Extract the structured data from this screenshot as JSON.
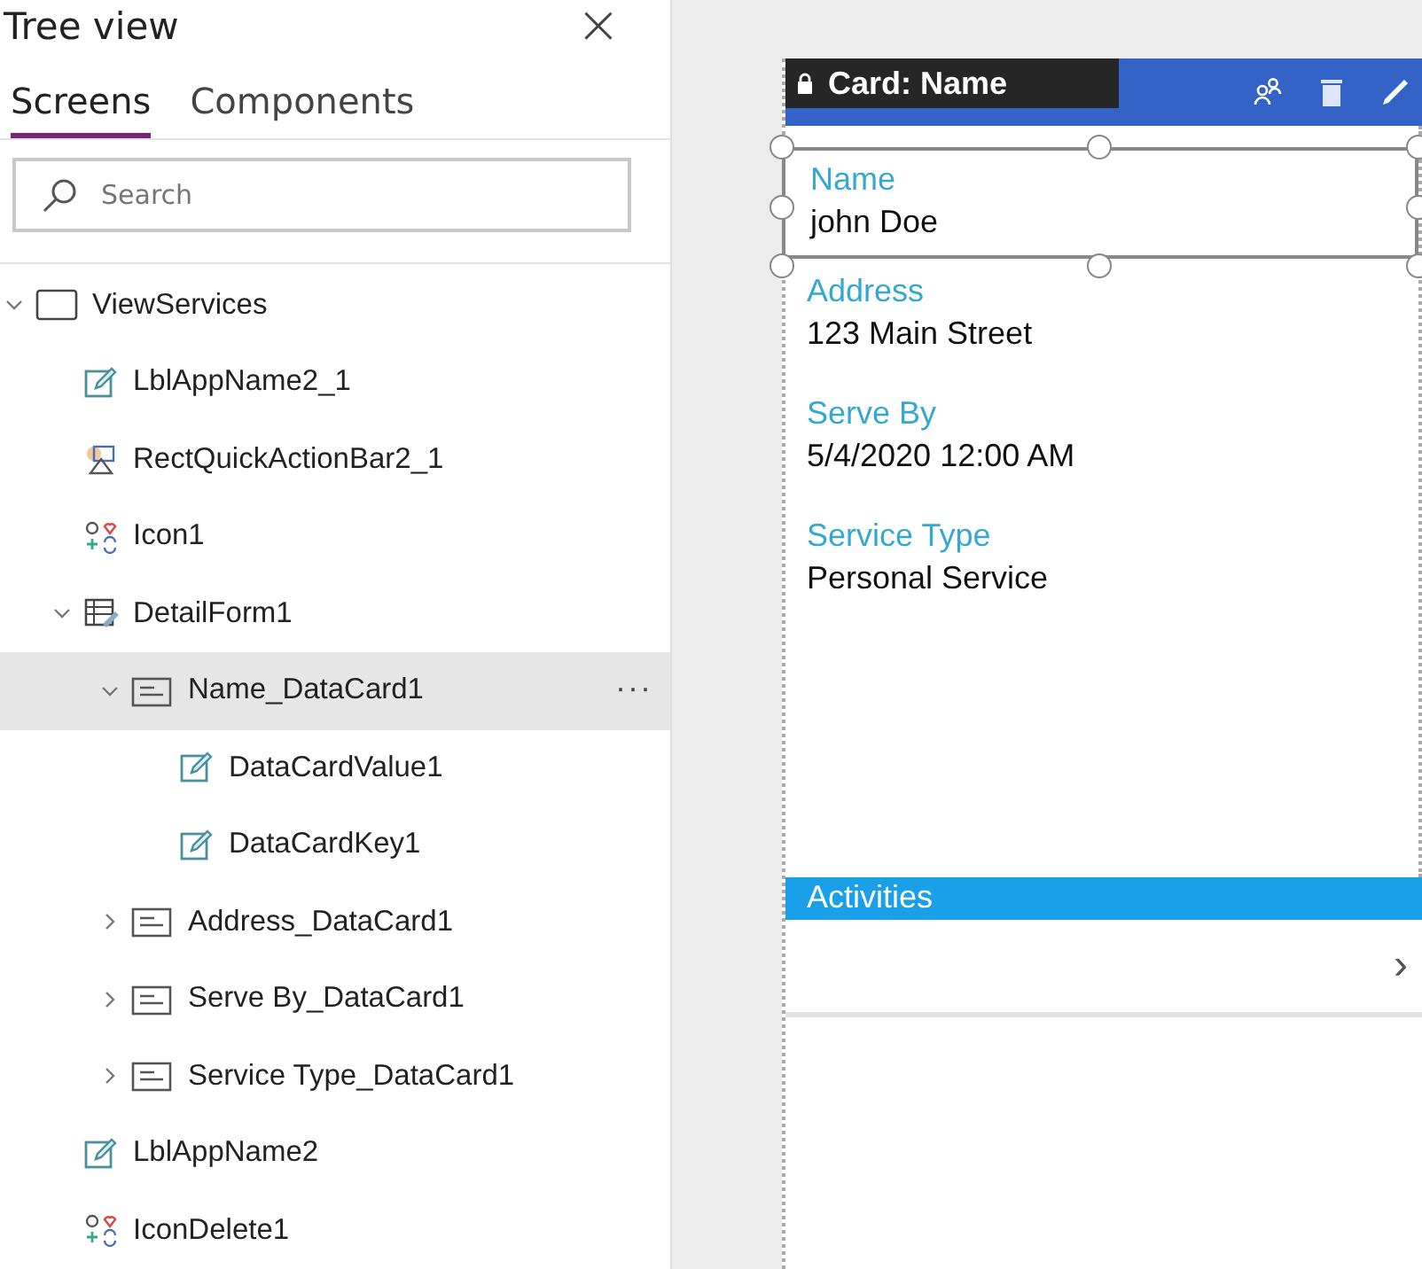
{
  "panel": {
    "title": "Tree view",
    "close": "×"
  },
  "tabs": [
    {
      "label": "Screens",
      "selected": true
    },
    {
      "label": "Components",
      "selected": false
    }
  ],
  "search": {
    "placeholder": "Search"
  },
  "tree": [
    {
      "name": "ViewServices",
      "kind": "screen",
      "expanded": true,
      "selected": false,
      "children": [
        {
          "name": "LblAppName2_1",
          "kind": "label",
          "selected": false
        },
        {
          "name": "RectQuickActionBar2_1",
          "kind": "rect",
          "selected": false
        },
        {
          "name": "Icon1",
          "kind": "icon",
          "selected": false
        },
        {
          "name": "DetailForm1",
          "kind": "form",
          "expanded": true,
          "selected": false,
          "children": [
            {
              "name": "Name_DataCard1",
              "kind": "card",
              "expanded": true,
              "selected": true,
              "children": [
                {
                  "name": "DataCardValue1",
                  "kind": "label",
                  "selected": false
                },
                {
                  "name": "DataCardKey1",
                  "kind": "label",
                  "selected": false
                }
              ]
            },
            {
              "name": "Address_DataCard1",
              "kind": "card",
              "expanded": false,
              "selected": false
            },
            {
              "name": "Serve By_DataCard1",
              "kind": "card",
              "expanded": false,
              "selected": false
            },
            {
              "name": "Service Type_DataCard1",
              "kind": "card",
              "expanded": false,
              "selected": false
            }
          ]
        },
        {
          "name": "LblAppName2",
          "kind": "label",
          "selected": false
        },
        {
          "name": "IconDelete1",
          "kind": "icon",
          "selected": false
        }
      ]
    }
  ],
  "more": "···",
  "canvas": {
    "tooltip": "Card: Name",
    "fields": [
      {
        "label": "Name",
        "value": "john Doe",
        "selected": true
      },
      {
        "label": "Address",
        "value": "123 Main Street",
        "selected": false
      },
      {
        "label": "Serve By",
        "value": "5/4/2020 12:00 AM",
        "selected": false
      },
      {
        "label": "Service Type",
        "value": "Personal Service",
        "selected": false
      }
    ],
    "section": "Activities",
    "chevron": "›"
  }
}
